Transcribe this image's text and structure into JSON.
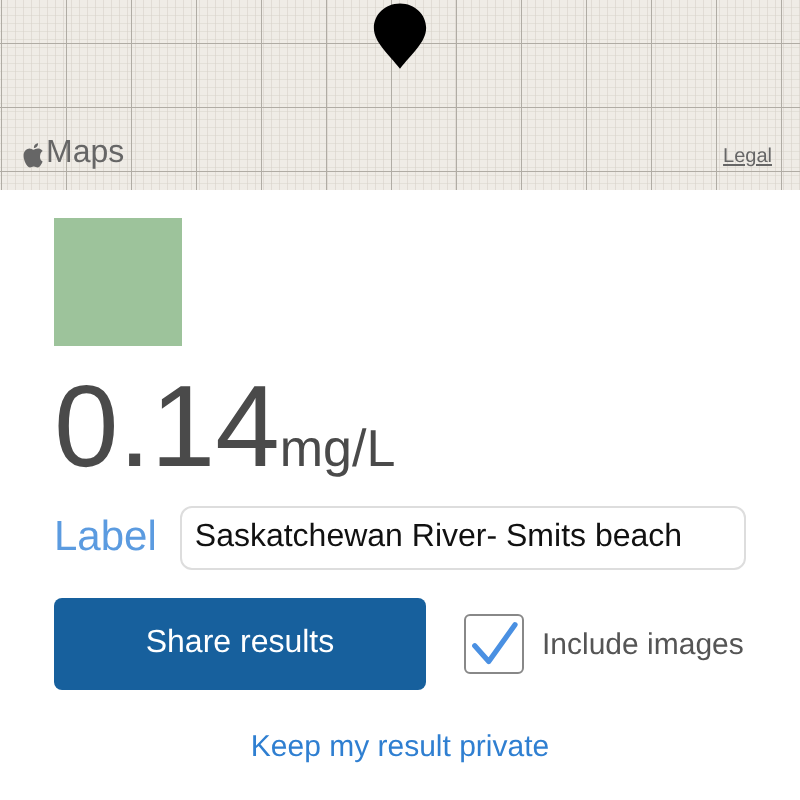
{
  "map": {
    "kind": "picture",
    "attribution": "Maps",
    "legal_link": "Legal"
  },
  "swatch": {
    "color": "#9dc39b"
  },
  "reading": {
    "value": "0.14",
    "unit": "mg/L"
  },
  "label_field": {
    "label": "Label",
    "value": "Saskatchewan River- Smits beach"
  },
  "share_button": {
    "label": "Share results"
  },
  "include_images": {
    "label": "Include images",
    "checked": true
  },
  "private_link": {
    "label": "Keep my result private"
  }
}
